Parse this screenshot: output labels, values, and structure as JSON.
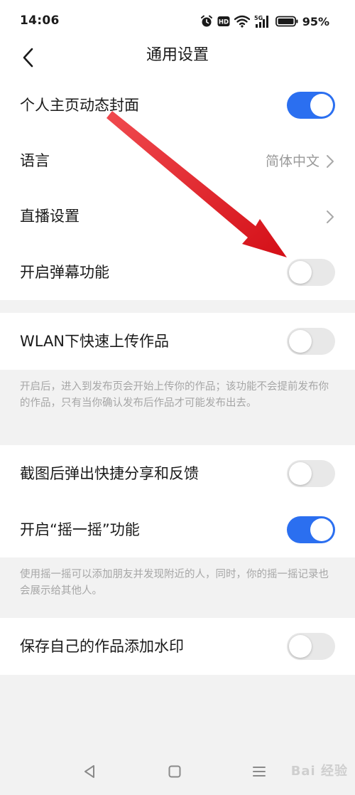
{
  "status_bar": {
    "time": "14:06",
    "network": "5G",
    "battery": "95%"
  },
  "header": {
    "title": "通用设置"
  },
  "section1": {
    "items": [
      {
        "label": "个人主页动态封面",
        "control": "toggle",
        "state": "on"
      },
      {
        "label": "语言",
        "control": "link",
        "value": "简体中文"
      },
      {
        "label": "直播设置",
        "control": "link",
        "value": ""
      },
      {
        "label": "开启弹幕功能",
        "control": "toggle",
        "state": "off"
      }
    ]
  },
  "section2": {
    "items": [
      {
        "label": "WLAN下快速上传作品",
        "control": "toggle",
        "state": "off"
      }
    ],
    "description": "开启后，进入到发布页会开始上传你的作品；该功能不会提前发布你的作品，只有当你确认发布后作品才可能发布出去。"
  },
  "section3": {
    "items": [
      {
        "label": "截图后弹出快捷分享和反馈",
        "control": "toggle",
        "state": "off"
      },
      {
        "label": "开启“摇一摇”功能",
        "control": "toggle",
        "state": "on"
      }
    ],
    "description": "使用摇一摇可以添加朋友并发现附近的人，同时，你的摇一摇记录也会展示给其他人。"
  },
  "section4": {
    "items": [
      {
        "label": "保存自己的作品添加水印",
        "control": "toggle",
        "state": "off"
      }
    ]
  },
  "watermark": "Bai 经验",
  "colors": {
    "toggle_on": "#2b6ff0",
    "toggle_off": "#e8e8e8",
    "annotation_arrow": "#e8141b"
  }
}
